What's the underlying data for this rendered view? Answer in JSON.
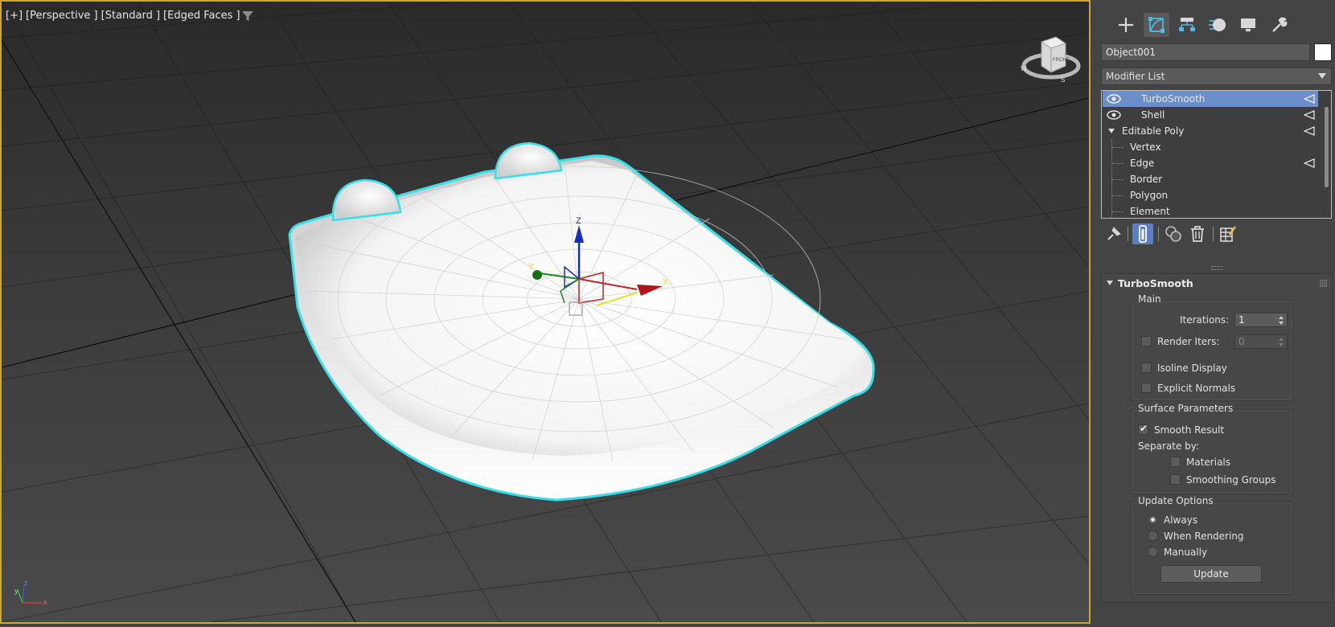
{
  "viewport": {
    "label_parts": [
      "[+]",
      "[Perspective ]",
      "[Standard ]",
      "[Edged Faces ]"
    ],
    "gizmo_axes": {
      "x": "X",
      "y": "Y",
      "z": "Z"
    },
    "tripod_axes": {
      "x": "x",
      "y": "y",
      "z": "z"
    },
    "viewcube_face": "FRONT",
    "compass": {
      "w": "W",
      "s": "S"
    },
    "selection_color": "#36e0ea",
    "border_color": "#c8a83a"
  },
  "command_panel": {
    "tabs": [
      "create-icon",
      "modify-icon",
      "hierarchy-icon",
      "motion-icon",
      "display-icon",
      "utilities-icon"
    ],
    "active_tab": "modify-icon",
    "object_name": "Object001",
    "object_color": "#ffffff",
    "modifier_list": "Modifier List",
    "stack": {
      "items": [
        {
          "label": "TurboSmooth",
          "selected": true
        },
        {
          "label": "Shell",
          "selected": false
        },
        {
          "label": "Editable Poly",
          "selected": false
        },
        {
          "label": "Vertex",
          "selected": false
        },
        {
          "label": "Edge",
          "selected": false
        },
        {
          "label": "Border",
          "selected": false
        },
        {
          "label": "Polygon",
          "selected": false
        },
        {
          "label": "Element",
          "selected": false
        }
      ]
    },
    "stack_tools": [
      "pin-stack-icon",
      "show-end-result-icon",
      "make-unique-icon",
      "remove-modifier-icon",
      "configure-sets-icon"
    ]
  },
  "turbosmooth": {
    "title": "TurboSmooth",
    "main": {
      "title": "Main",
      "iterations_label": "Iterations:",
      "iterations_value": "1",
      "render_iters_label": "Render Iters:",
      "render_iters_value": "0",
      "render_iters_checked": false,
      "isoline_label": "Isoline Display",
      "isoline_checked": false,
      "explicit_normals_label": "Explicit Normals",
      "explicit_normals_checked": false
    },
    "surface": {
      "title": "Surface Parameters",
      "smooth_result_label": "Smooth Result",
      "smooth_result_checked": true,
      "separate_by_label": "Separate by:",
      "materials_label": "Materials",
      "materials_checked": false,
      "smoothing_groups_label": "Smoothing Groups",
      "smoothing_groups_checked": false
    },
    "update_options": {
      "title": "Update Options",
      "always_label": "Always",
      "when_rendering_label": "When Rendering",
      "manually_label": "Manually",
      "selected": "Always",
      "update_button": "Update"
    }
  }
}
